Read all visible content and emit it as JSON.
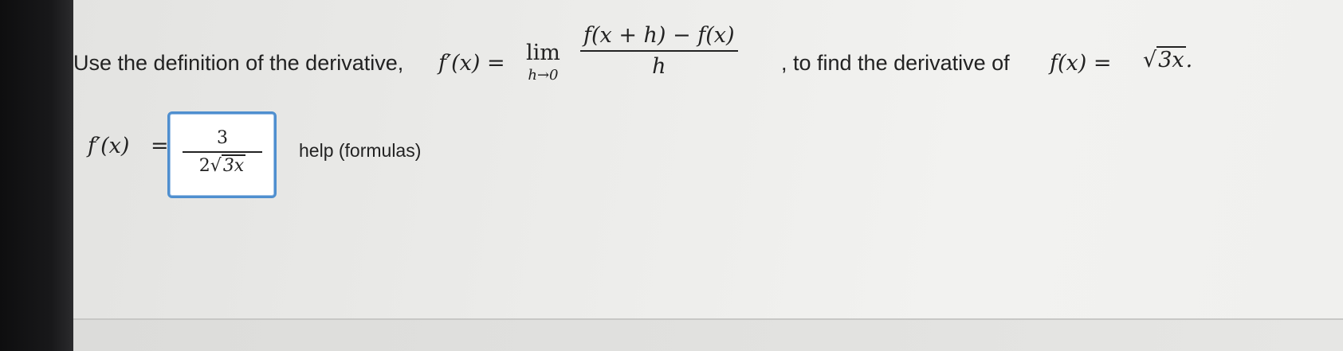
{
  "question": {
    "prefix": "Use the definition of the derivative,",
    "fprime_label": "f′(x) =",
    "lim_word": "lim",
    "lim_sub": "h→0",
    "frac_num": "f(x + h) − f(x)",
    "frac_den": "h",
    "middle": ", to find the derivative of",
    "func_label": "f(x) =",
    "radicand": "3x",
    "suffix": "."
  },
  "answer": {
    "label": "f′(x)",
    "equals": "=",
    "num": "3",
    "den_coef": "2",
    "den_radicand": "3x",
    "help_text": "help (formulas)"
  },
  "colors": {
    "box_border": "#4f8fcf",
    "text": "#222222"
  }
}
